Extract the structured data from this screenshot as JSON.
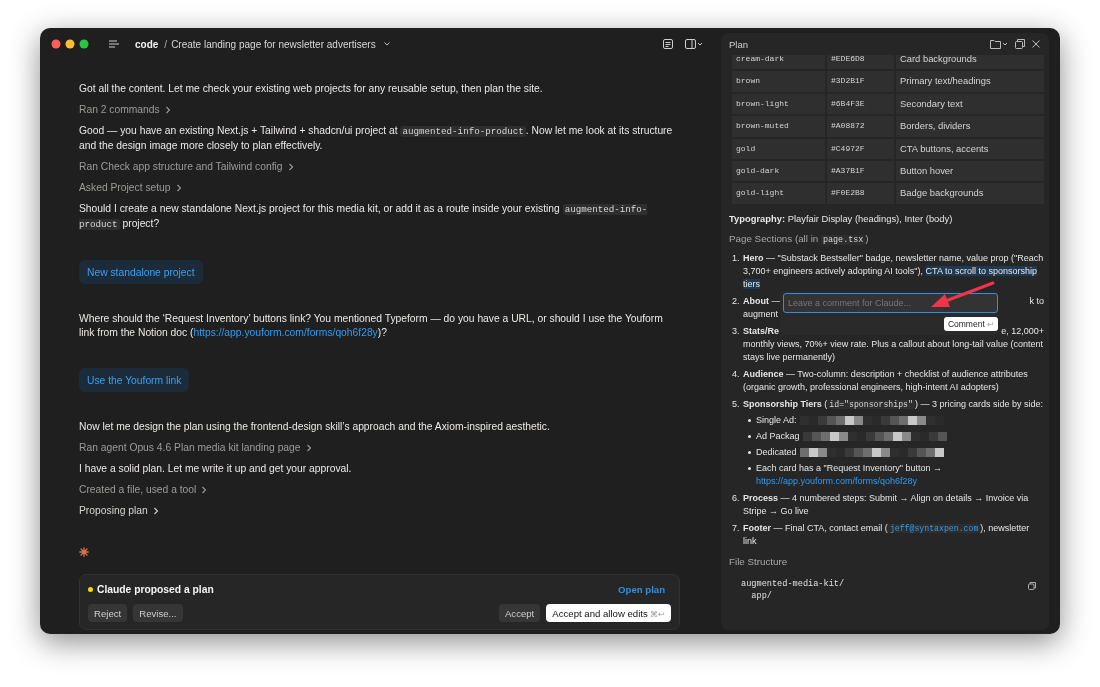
{
  "window": {
    "breadcrumb_root": "code",
    "separator": "/",
    "title": "Create landing page for newsletter advertisers"
  },
  "messages": [
    {
      "kind": "text",
      "segments": [
        {
          "kind": "text",
          "text": "Got all the content. Let me check your existing web projects for any reusable setup, then plan the site."
        }
      ]
    },
    {
      "kind": "step",
      "label": "Ran 2 commands",
      "active": false
    },
    {
      "kind": "text",
      "segments": [
        {
          "kind": "text",
          "text": "Good — you have an existing Next.js + Tailwind + shadcn/ui project at "
        },
        {
          "kind": "code",
          "text": "augmented-info-product"
        },
        {
          "kind": "text",
          "text": ". Now let me look at its structure and the design image more closely to plan effectively."
        }
      ]
    },
    {
      "kind": "step",
      "label": "Ran Check app structure and Tailwind config",
      "active": false
    },
    {
      "kind": "step",
      "label": "Asked Project setup",
      "active": false
    },
    {
      "kind": "text",
      "segments": [
        {
          "kind": "text",
          "text": "Should I create a new standalone Next.js project for this media kit, or add it as a route inside your existing "
        },
        {
          "kind": "code",
          "text": "augmented-info-product"
        },
        {
          "kind": "text",
          "text": " project?"
        }
      ]
    },
    {
      "kind": "choice",
      "label": "New standalone project"
    },
    {
      "kind": "text",
      "segments": [
        {
          "kind": "text",
          "text": "Where should the ‘Request Inventory’ buttons link? You mentioned Typeform — do you have a URL, or should I use the Youform link from the Notion doc ("
        },
        {
          "kind": "link",
          "text": "https://app.youform.com/forms/qoh6f28y"
        },
        {
          "kind": "text",
          "text": ")?"
        }
      ]
    },
    {
      "kind": "choice",
      "label": "Use the Youform link"
    },
    {
      "kind": "text",
      "segments": [
        {
          "kind": "text",
          "text": "Now let me design the plan using the frontend-design skill’s approach and the Axiom-inspired aesthetic."
        }
      ]
    },
    {
      "kind": "step",
      "label": "Ran agent Opus 4.6 Plan media kit landing page",
      "active": false
    },
    {
      "kind": "text",
      "segments": [
        {
          "kind": "text",
          "text": "I have a solid plan. Let me write it up and get your approval."
        }
      ]
    },
    {
      "kind": "step",
      "label": "Created a file, used a tool",
      "active": false
    },
    {
      "kind": "step",
      "label": "Proposing plan",
      "active": true
    },
    {
      "kind": "spinner"
    }
  ],
  "approval": {
    "title": "Claude proposed a plan",
    "open_link": "Open plan",
    "left_buttons": [
      {
        "label": "Reject"
      },
      {
        "label": "Revise..."
      }
    ],
    "right_buttons": [
      {
        "label": "Accept",
        "primary": false
      },
      {
        "label": "Accept and allow edits",
        "primary": true,
        "shortcut": "⌘↩"
      }
    ]
  },
  "plan": {
    "title": "Plan",
    "color_table": {
      "rows": [
        {
          "token": "cream-dark",
          "hex": "#EDE6D8",
          "usage": "Card backgrounds"
        },
        {
          "token": "brown",
          "hex": "#3D2B1F",
          "usage": "Primary text/headings"
        },
        {
          "token": "brown-light",
          "hex": "#6B4F3E",
          "usage": "Secondary text"
        },
        {
          "token": "brown-muted",
          "hex": "#A08872",
          "usage": "Borders, dividers"
        },
        {
          "token": "gold",
          "hex": "#C4972F",
          "usage": "CTA buttons, accents"
        },
        {
          "token": "gold-dark",
          "hex": "#A37B1F",
          "usage": "Button hover"
        },
        {
          "token": "gold-light",
          "hex": "#F0E2B8",
          "usage": "Badge backgrounds"
        }
      ]
    },
    "typography": "**Typography:** Playfair Display (headings), Inter (body)",
    "sections_heading": [
      {
        "kind": "text",
        "text": "Page Sections (all in "
      },
      {
        "kind": "code",
        "text": "page.tsx"
      },
      {
        "kind": "text",
        "text": ")"
      }
    ],
    "sections": [
      {
        "kind": "normal",
        "number": "1.",
        "segments": [
          {
            "kind": "text",
            "text": "**Hero** — \"Substack Bestseller\" badge, newsletter name, value prop (\"Reach 3,700+ engineers actively adopting AI tools\"), "
          },
          {
            "kind": "highlight",
            "text": "CTA to scroll to sponsorship tiers"
          }
        ]
      },
      {
        "kind": "obscured",
        "number": "2.",
        "lines": [
          [
            "**About** —",
            "k to"
          ],
          [
            "augment"
          ]
        ]
      },
      {
        "kind": "obscured",
        "number": "3.",
        "lines": [
          [
            "**Stats/Re**",
            "e, 12,000+"
          ],
          [
            "monthly views, 70%+ view rate. Plus a callout about long-tail value (content stays live permanently)"
          ]
        ]
      },
      {
        "kind": "normal",
        "number": "4.",
        "segments": [
          {
            "kind": "text",
            "text": "**Audience** — Two-column: description + checklist of audience attributes (organic growth, professional engineers, high-intent AI adopters)"
          }
        ]
      },
      {
        "kind": "normal",
        "number": "5.",
        "segments": [
          {
            "kind": "text",
            "text": "**Sponsorship Tiers** ("
          },
          {
            "kind": "code",
            "text": "id=\"sponsorships\""
          },
          {
            "kind": "text",
            "text": ") — 3 pricing cards side by side:"
          }
        ],
        "bullets": [
          {
            "kind": "redacted",
            "text": "Single Ad:"
          },
          {
            "kind": "redacted",
            "text": "Ad Packag"
          },
          {
            "kind": "redacted",
            "text": "Dedicated"
          },
          {
            "kind": "normal",
            "segments": [
              {
                "kind": "text",
                "text": "Each card has a \"Request Inventory\" button → "
              },
              {
                "kind": "link",
                "text": "https://app.youform.com/forms/qoh6f28y"
              }
            ]
          }
        ]
      },
      {
        "kind": "normal",
        "number": "6.",
        "segments": [
          {
            "kind": "text",
            "text": "**Process** — 4 numbered steps: Submit → Align on details → Invoice via Stripe → Go live"
          }
        ]
      },
      {
        "kind": "normal",
        "number": "7.",
        "segments": [
          {
            "kind": "text",
            "text": "**Footer** — Final CTA, contact email ("
          },
          {
            "kind": "code_link",
            "text": "jeff@syntaxpen.com"
          },
          {
            "kind": "text",
            "text": "), newsletter link"
          }
        ]
      }
    ],
    "file_structure": {
      "heading": "File Structure",
      "lines": [
        "augmented-media-kit/",
        "  app/"
      ]
    },
    "comment": {
      "placeholder": "Leave a comment for Claude...",
      "focused": true,
      "button": "Comment",
      "shortcut": "↩"
    }
  }
}
